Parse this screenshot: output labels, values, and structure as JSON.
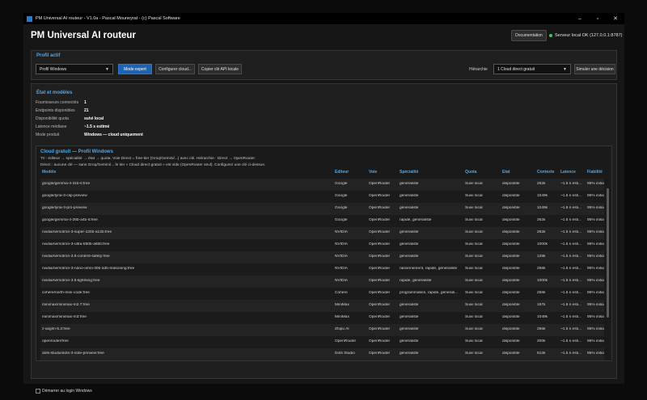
{
  "window": {
    "title": "PM Universal AI routeur - V1.0a - Pascal Mouneyrat - (c) Pascal Software"
  },
  "header": {
    "app_title": "PM Universal AI routeur",
    "doc_button": "Documentation",
    "server_status": "Serveur local OK (127.0.0.1:8787)",
    "status_color": "#3ec46d"
  },
  "profil": {
    "title": "Profil actif",
    "selected_profile": "Profil Windows",
    "mode_button": "Mode expert",
    "configure_button": "Configurer cloud...",
    "copy_button": "Copier clé API locale",
    "hierarchy_label": "Hiérarchie",
    "hierarchy_value": "1  Cloud direct gratuit",
    "simulate_button": "Simuler une décision"
  },
  "etat": {
    "title": "État et modèles",
    "stats": [
      {
        "label": "Fournisseurs connectés",
        "value": "1"
      },
      {
        "label": "Endpoints disponibles",
        "value": "21"
      },
      {
        "label": "Disponibilité quota",
        "value": "suivi local"
      },
      {
        "label": "Latence médiane",
        "value": "~1.5 s estimé"
      },
      {
        "label": "Mode produit",
        "value": "Windows — cloud uniquement"
      }
    ]
  },
  "cloud": {
    "title": "Cloud gratuit — Profil Windows",
    "desc_line1": "Tri : éditeur → spécialité → état → quota. Voie Direct = free-tier (Groq/Gemini/...) avec clé. Hiérarchie : Direct → OpenRouter.",
    "desc_line2": "Direct : aucune clé — sans Groq/Gemini/... le tier « Cloud direct gratuit » est vide (OpenRouter seul). Configurez une clé ci-dessus.",
    "columns": {
      "model": "Modèle",
      "editeur": "Éditeur",
      "voie": "Voie",
      "specialite": "Spécialité",
      "quota": "Quota",
      "etat": "État",
      "contexte": "Contexte",
      "latence": "Latence",
      "fiabilite": "Fiabilité"
    },
    "rows": [
      {
        "model": "google/gemma-4-31b-it:free",
        "editeur": "Google",
        "voie": "OpenRouter",
        "specialite": "généraliste",
        "quota": "Suivi local",
        "etat": "disponible",
        "contexte": "262k",
        "latence": "~1.5 s esti...",
        "fiabilite": "95% initial"
      },
      {
        "model": "google/lyria-3-clip-preview",
        "editeur": "Google",
        "voie": "OpenRouter",
        "specialite": "généraliste",
        "quota": "Suivi local",
        "etat": "disponible",
        "contexte": "1049k",
        "latence": "~1.5 s esti...",
        "fiabilite": "95% initial"
      },
      {
        "model": "google/lyria-3-pro-preview",
        "editeur": "Google",
        "voie": "OpenRouter",
        "specialite": "généraliste",
        "quota": "Suivi local",
        "etat": "disponible",
        "contexte": "1049k",
        "latence": "~1.5 s esti...",
        "fiabilite": "95% initial"
      },
      {
        "model": "google/gemma-4-26b-a4b-it:free",
        "editeur": "Google",
        "voie": "OpenRouter",
        "specialite": "rapide, généraliste",
        "quota": "Suivi local",
        "etat": "disponible",
        "contexte": "262k",
        "latence": "~1.5 s esti...",
        "fiabilite": "95% initial"
      },
      {
        "model": "nvidia/nemotron-3-super-120b-a12b:free",
        "editeur": "NVIDIA",
        "voie": "OpenRouter",
        "specialite": "généraliste",
        "quota": "Suivi local",
        "etat": "disponible",
        "contexte": "262k",
        "latence": "~1.5 s esti...",
        "fiabilite": "95% initial"
      },
      {
        "model": "nvidia/nemotron-3-ultra-550b-a55b:free",
        "editeur": "NVIDIA",
        "voie": "OpenRouter",
        "specialite": "généraliste",
        "quota": "Suivi local",
        "etat": "disponible",
        "contexte": "1000k",
        "latence": "~1.5 s esti...",
        "fiabilite": "95% initial"
      },
      {
        "model": "nvidia/nemotron-3.5-content-safety:free",
        "editeur": "NVIDIA",
        "voie": "OpenRouter",
        "specialite": "généraliste",
        "quota": "Suivi local",
        "etat": "disponible",
        "contexte": "128k",
        "latence": "~1.5 s esti...",
        "fiabilite": "95% initial"
      },
      {
        "model": "nvidia/nemotron-3-nano-omni-30b-a3b-reasoning:free",
        "editeur": "NVIDIA",
        "voie": "OpenRouter",
        "specialite": "raisonnement, rapide, généraliste",
        "quota": "Suivi local",
        "etat": "disponible",
        "contexte": "256k",
        "latence": "~1.5 s esti...",
        "fiabilite": "95% initial"
      },
      {
        "model": "nvidia/nemotron-3.5-lightning:free",
        "editeur": "NVIDIA",
        "voie": "OpenRouter",
        "specialite": "rapide, généraliste",
        "quota": "Suivi local",
        "etat": "disponible",
        "contexte": "1000k",
        "latence": "~1.5 s esti...",
        "fiabilite": "95% initial"
      },
      {
        "model": "cohere/north-mini-code:free",
        "editeur": "Cohere",
        "voie": "OpenRouter",
        "specialite": "programmation, rapide, générali...",
        "quota": "Suivi local",
        "etat": "disponible",
        "contexte": "256k",
        "latence": "~1.5 s esti...",
        "fiabilite": "95% initial"
      },
      {
        "model": "minimax/minimax-m2.7:free",
        "editeur": "MiniMax",
        "voie": "OpenRouter",
        "specialite": "généraliste",
        "quota": "Suivi local",
        "etat": "disponible",
        "contexte": "197k",
        "latence": "~1.5 s esti...",
        "fiabilite": "95% initial"
      },
      {
        "model": "minimax/minimax-m3:free",
        "editeur": "MiniMax",
        "voie": "OpenRouter",
        "specialite": "généraliste",
        "quota": "Suivi local",
        "etat": "disponible",
        "contexte": "1049k",
        "latence": "~1.5 s esti...",
        "fiabilite": "95% initial"
      },
      {
        "model": "z-ai/glm-5.2:free",
        "editeur": "Zhipu AI",
        "voie": "OpenRouter",
        "specialite": "généraliste",
        "quota": "Suivi local",
        "etat": "disponible",
        "contexte": "256k",
        "latence": "~1.5 s esti...",
        "fiabilite": "95% initial"
      },
      {
        "model": "openrouter/free",
        "editeur": "OpenRouter",
        "voie": "OpenRouter",
        "specialite": "généraliste",
        "quota": "Suivi local",
        "etat": "disponible",
        "contexte": "200k",
        "latence": "~1.5 s esti...",
        "fiabilite": "95% initial"
      },
      {
        "model": "dots-studio/dots-3-note-preview:free",
        "editeur": "Dots Studio",
        "voie": "OpenRouter",
        "specialite": "généraliste",
        "quota": "Suivi local",
        "etat": "disponible",
        "contexte": "512k",
        "latence": "~1.5 s esti...",
        "fiabilite": "95% initial"
      }
    ]
  },
  "footer": {
    "startup_label": "Démarrer au login Windows"
  },
  "colors": {
    "accent": "#4fa8e8",
    "primary_button": "#1f64b0"
  }
}
